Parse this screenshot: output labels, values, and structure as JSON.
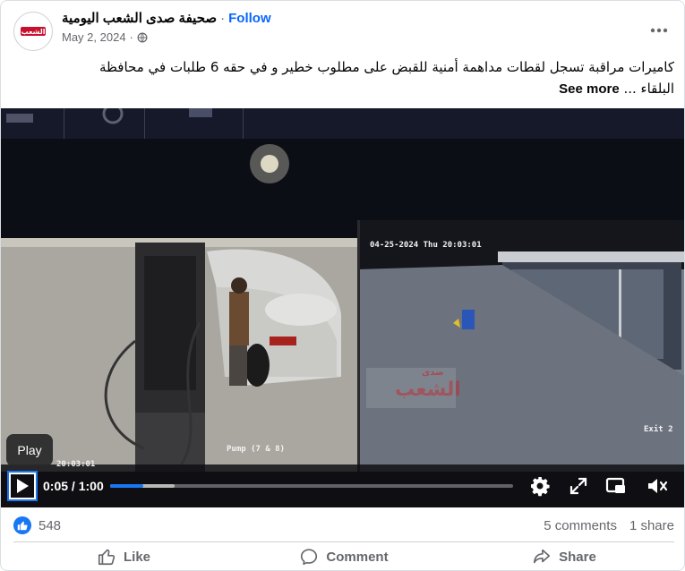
{
  "post": {
    "page_name": "صحيفة صدى الشعب اليومية",
    "separator": "·",
    "follow_label": "Follow",
    "date": "May 2, 2024",
    "date_separator": "·",
    "avatar_logo_text": "الشعب",
    "text_line1": "كاميرات مراقبة تسجل لقطات مداهمة أمنية للقبض على مطلوب خطير و في حقه 6  طلبات في محافظة",
    "text_line2": "البلقاء ...",
    "see_more_label": "See more"
  },
  "video": {
    "overlay_timestamp_right": "04-25-2024 Thu 20:03:01",
    "overlay_timestamp_left": "20:03:01",
    "overlay_pump_label": "Pump (7 & 8)",
    "overlay_exit_label": "Exit 2",
    "watermark_text": "الشعب",
    "watermark_small": "صدى",
    "tooltip": "Play",
    "current_time": "0:05",
    "time_separator": " / ",
    "duration": "1:00",
    "progress_fraction": 0.083,
    "buffer_fraction": 0.16,
    "controls": [
      "settings-icon",
      "fullscreen-icon",
      "picture-in-picture-icon",
      "volume-muted-icon"
    ]
  },
  "stats": {
    "like_count": "548",
    "comments": "5 comments",
    "shares": "1 share"
  },
  "actions": {
    "like": "Like",
    "comment": "Comment",
    "share": "Share"
  },
  "colors": {
    "brand_blue": "#0866ff",
    "like_blue": "#1877f2",
    "secondary_text": "#65676b"
  }
}
